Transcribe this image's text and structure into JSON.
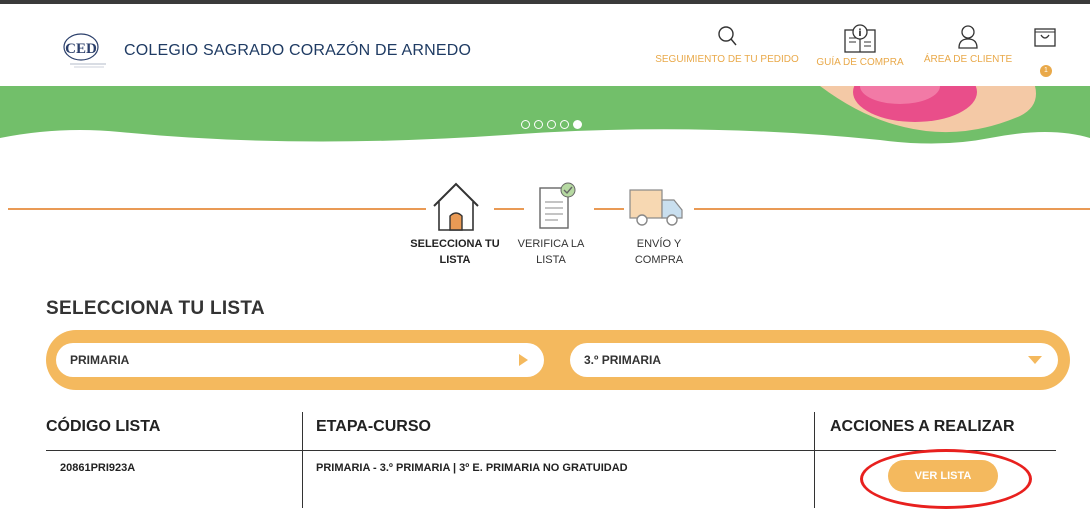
{
  "header": {
    "school_name": "COLEGIO SAGRADO CORAZÓN DE ARNEDO",
    "nav": [
      {
        "label": "SEGUIMIENTO DE TU PEDIDO",
        "icon": "search-icon"
      },
      {
        "label": "GUÍA DE COMPRA",
        "icon": "book-guide-icon"
      },
      {
        "label": "ÁREA DE CLIENTE",
        "icon": "user-icon"
      }
    ],
    "cart_count": "1",
    "accent": "#e9a94a"
  },
  "banner": {
    "color": "#72bf6a",
    "slides_total": 5,
    "active_slide": 5
  },
  "steps": [
    {
      "label_line1": "SELECCIONA TU",
      "label_line2": "LISTA",
      "icon": "house-icon",
      "active": true
    },
    {
      "label_line1": "VERIFICA LA",
      "label_line2": "LISTA",
      "icon": "checklist-icon",
      "active": false
    },
    {
      "label_line1": "ENVÍO Y",
      "label_line2": "COMPRA",
      "icon": "truck-icon",
      "active": false
    }
  ],
  "section_title": "SELECCIONA TU LISTA",
  "selects": {
    "etapa": "PRIMARIA",
    "curso": "3.º PRIMARIA"
  },
  "table": {
    "headers": [
      "CÓDIGO LISTA",
      "ETAPA-CURSO",
      "ACCIONES A REALIZAR"
    ],
    "rows": [
      {
        "codigo": "20861PRI923A",
        "etapa_curso": "PRIMARIA - 3.º PRIMARIA | 3º E. PRIMARIA NO GRATUIDAD",
        "action": "VER LISTA"
      }
    ]
  },
  "colors": {
    "orange": "#f4b95e",
    "line": "#e99a55",
    "highlight_circle": "#e8201e"
  }
}
